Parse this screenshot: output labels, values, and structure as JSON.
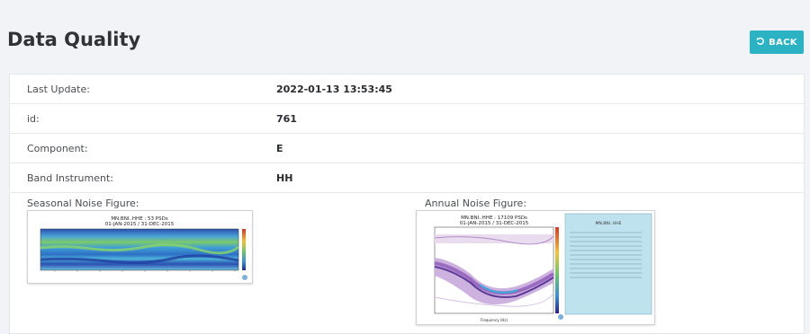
{
  "page_title": "Data Quality",
  "back_button": {
    "label": "BACK",
    "icon": "undo-icon"
  },
  "details": [
    {
      "label": "Last Update:",
      "value": "2022-01-13 13:53:45"
    },
    {
      "label": "id:",
      "value": "761"
    },
    {
      "label": "Component:",
      "value": "E"
    },
    {
      "label": "Band Instrument:",
      "value": "HH"
    }
  ],
  "figures": {
    "seasonal": {
      "label": "Seasonal Noise Figure:",
      "title": "MN.BNI..HHE : 53 PSDs",
      "subtitle": "01-JAN-2015 / 31-DEC-2015"
    },
    "annual": {
      "label": "Annual Noise Figure:",
      "title": "MN.BNI..HHE : 17109 PSDs",
      "subtitle": "01-JAN-2015 / 31-DEC-2015",
      "xlabel": "Frequency (Hz)",
      "stats_title": "MN.BNI..HHE"
    }
  }
}
